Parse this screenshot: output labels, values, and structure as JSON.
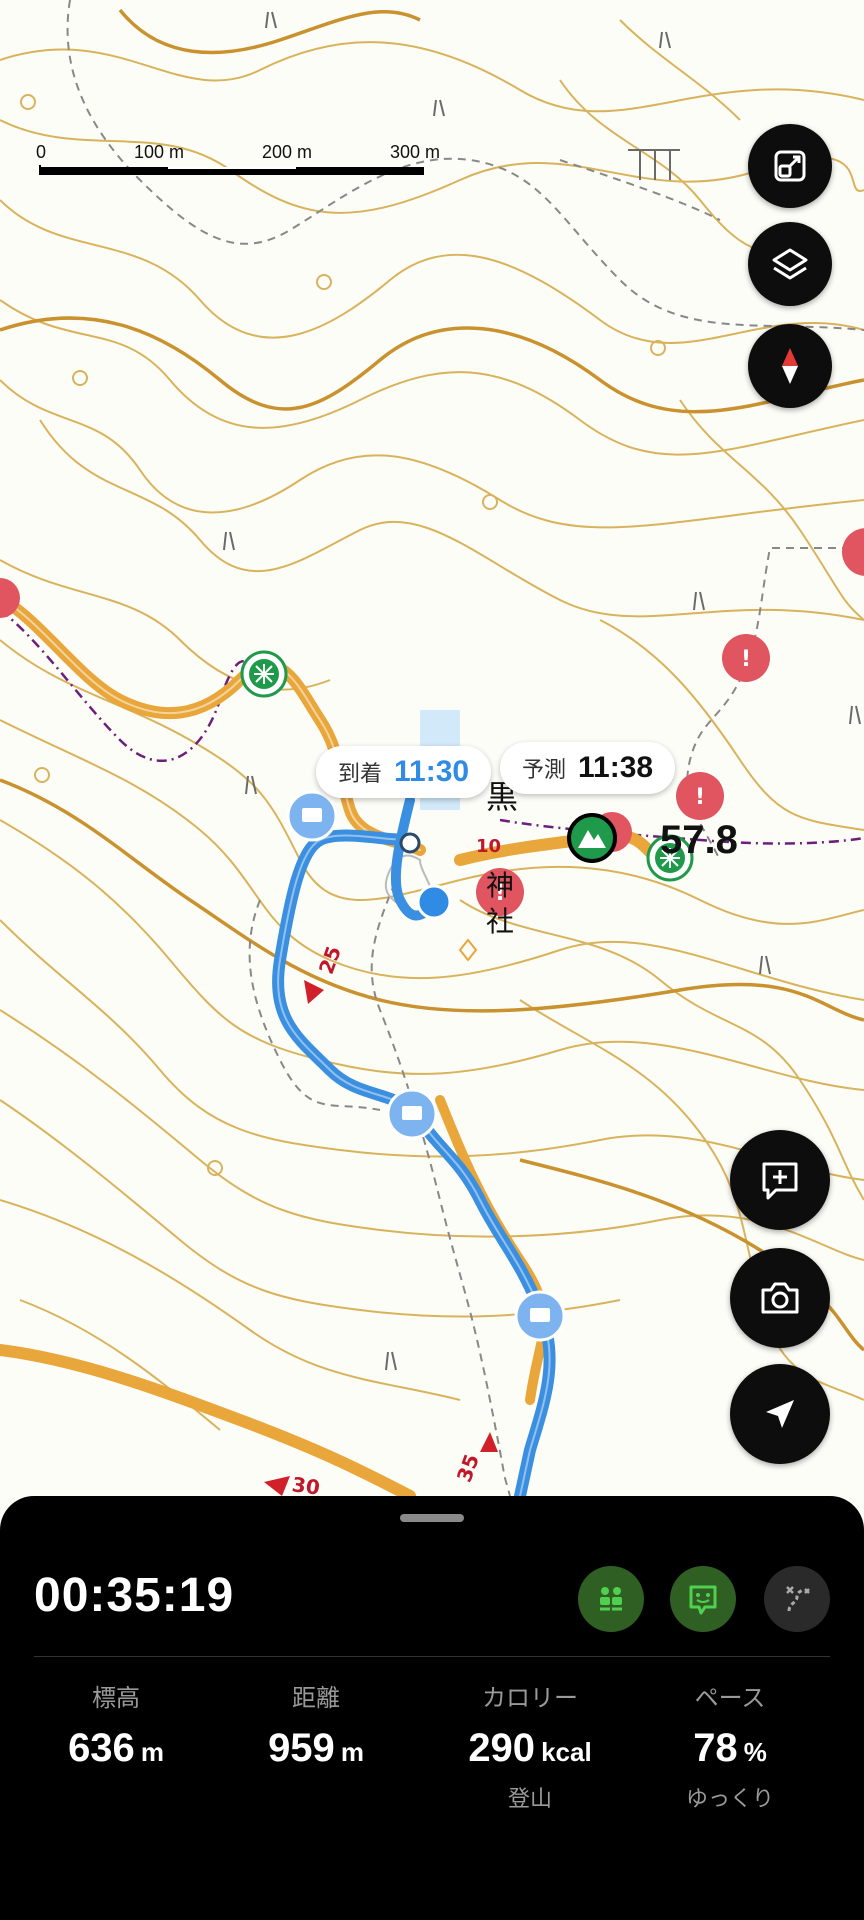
{
  "map": {
    "scale": {
      "labels": [
        "0",
        "100 m",
        "200 m",
        "300 m"
      ]
    },
    "arrival_bubble": {
      "label": "到着",
      "time": "11:30"
    },
    "forecast_bubble": {
      "label": "予測",
      "time": "11:38"
    },
    "place_chars": [
      "黒",
      "神",
      "社"
    ],
    "elevation_partial": "57.8",
    "course_markers": [
      "25",
      "35",
      "30",
      "10"
    ]
  },
  "controls": {
    "icons": [
      "fullscreen-icon",
      "layers-icon",
      "compass-icon",
      "add-note-icon",
      "camera-icon",
      "navigation-icon"
    ]
  },
  "panel": {
    "elapsed": "00:35:19",
    "stats": [
      {
        "title": "標高",
        "value": "636",
        "unit": "m",
        "sub": ""
      },
      {
        "title": "距離",
        "value": "959",
        "unit": "m",
        "sub": ""
      },
      {
        "title": "カロリー",
        "value": "290",
        "unit": "kcal",
        "sub": "登山"
      },
      {
        "title": "ペース",
        "value": "78",
        "unit": "%",
        "sub": "ゆっくり"
      }
    ]
  },
  "colors": {
    "route_blue": "#3b8fe0",
    "trail_orange": "#e9a63a",
    "contour": "#d9b35c",
    "danger_red": "#e05560",
    "accent_green": "#4fd04f"
  }
}
